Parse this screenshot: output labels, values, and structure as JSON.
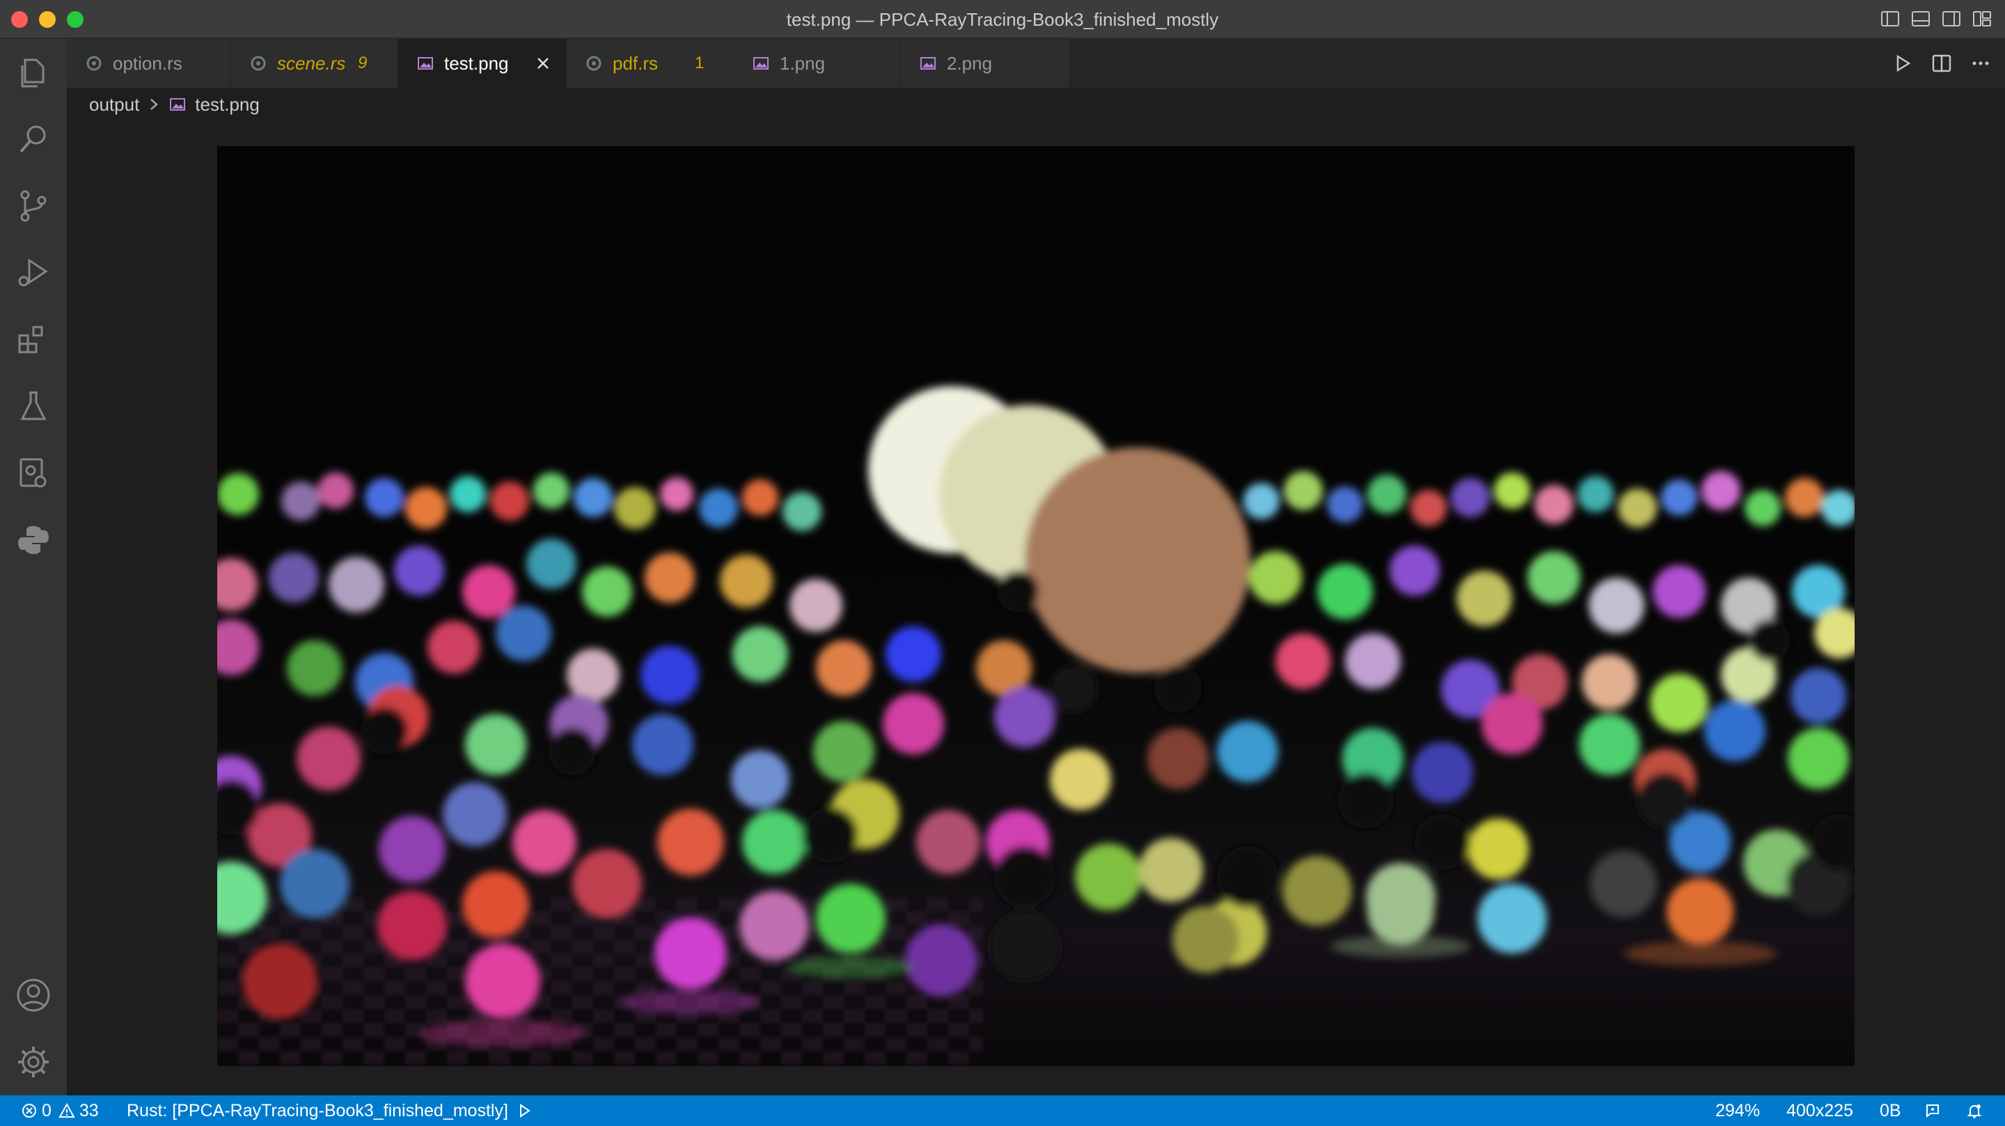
{
  "window": {
    "title": "test.png — PPCA-RayTracing-Book3_finished_mostly"
  },
  "activity_bar": {
    "items": [
      "explorer-icon",
      "search-icon",
      "source-control-icon",
      "run-debug-icon",
      "extensions-icon",
      "testing-icon",
      "remote-explorer-icon",
      "python-icon"
    ],
    "bottom": [
      "accounts-icon",
      "manage-gear-icon"
    ]
  },
  "tabs": [
    {
      "label": "option.rs",
      "type": "rust",
      "active": false
    },
    {
      "label": "scene.rs",
      "type": "rust",
      "active": false,
      "badge": "9",
      "modified_color": "#cca700"
    },
    {
      "label": "test.png",
      "type": "image",
      "active": true
    },
    {
      "label": "pdf.rs",
      "type": "rust",
      "active": false,
      "badge": "1",
      "modified_color": "#cca700"
    },
    {
      "label": "1.png",
      "type": "image",
      "active": false
    },
    {
      "label": "2.png",
      "type": "image",
      "active": false
    }
  ],
  "breadcrumb": {
    "folder": "output",
    "file": "test.png"
  },
  "status_bar": {
    "errors": "0",
    "warnings": "33",
    "rust_project": "Rust: [PPCA-RayTracing-Book3_finished_mostly]",
    "zoom": "294%",
    "image_size": "400x225",
    "file_size": "0B"
  },
  "colors": {
    "accent": "#007acc",
    "warning_yellow": "#cca700",
    "image_icon": "#b180d7",
    "rust_icon": "#6d8086"
  }
}
